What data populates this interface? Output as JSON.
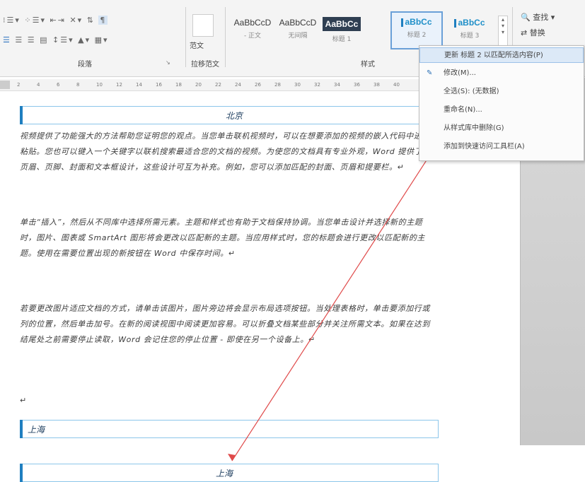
{
  "ribbon": {
    "paragraph_group_label": "段落",
    "font_cmd": "范文",
    "pinyin_group_label": "拉移范文",
    "styles_group_label": "样式",
    "styles": [
      {
        "sample": "AaBbCcD",
        "name": "- 正文"
      },
      {
        "sample": "AaBbCcD",
        "name": "无间隔"
      },
      {
        "sample": "AaBbCc",
        "name": "标题 1"
      },
      {
        "sample": "aBbCc",
        "name": "标题 2"
      },
      {
        "sample": "aBbCc",
        "name": "标题 3"
      }
    ],
    "find_label": "查找",
    "replace_label": "替换"
  },
  "ruler": {
    "ticks": [
      "2",
      "4",
      "6",
      "8",
      "10",
      "12",
      "14",
      "16",
      "18",
      "20",
      "22",
      "24",
      "26",
      "28",
      "30",
      "32",
      "34",
      "36",
      "38",
      "40"
    ]
  },
  "context_menu": {
    "items": [
      "更新 标题 2 以匹配所选内容(P)",
      "修改(M)...",
      "全选(S): (无数据)",
      "重命名(N)...",
      "从样式库中删除(G)",
      "添加到快速访问工具栏(A)"
    ]
  },
  "document": {
    "heading1": "北京",
    "para1": "视频提供了功能强大的方法帮助您证明您的观点。当您单击联机视频时，可以在想要添加的视频的嵌入代码中进行粘贴。您也可以键入一个关键字以联机搜索最适合您的文档的视频。为使您的文档具有专业外观，Word 提供了页眉、页脚、封面和文本框设计，这些设计可互为补充。例如，您可以添加匹配的封面、页眉和提要栏。↵",
    "para2": "单击“插入”，然后从不同库中选择所需元素。主题和样式也有助于文档保持协调。当您单击设计并选择新的主题时，图片、图表或 SmartArt 图形将会更改以匹配新的主题。当应用样式时，您的标题会进行更改以匹配新的主题。使用在需要位置出现的新按钮在 Word 中保存时间。↵",
    "para3": "若要更改图片适应文档的方式，请单击该图片，图片旁边将会显示布局选项按钮。当处理表格时，单击要添加行或列的位置，然后单击加号。在新的阅读视图中阅读更加容易。可以折叠文档某些部分并关注所需文本。如果在达到结尾处之前需要停止读取，Word 会记住您的停止位置 - 即使在另一个设备上。↵",
    "empty_mark": "↵",
    "heading2": "上海",
    "heading3": "上海"
  }
}
